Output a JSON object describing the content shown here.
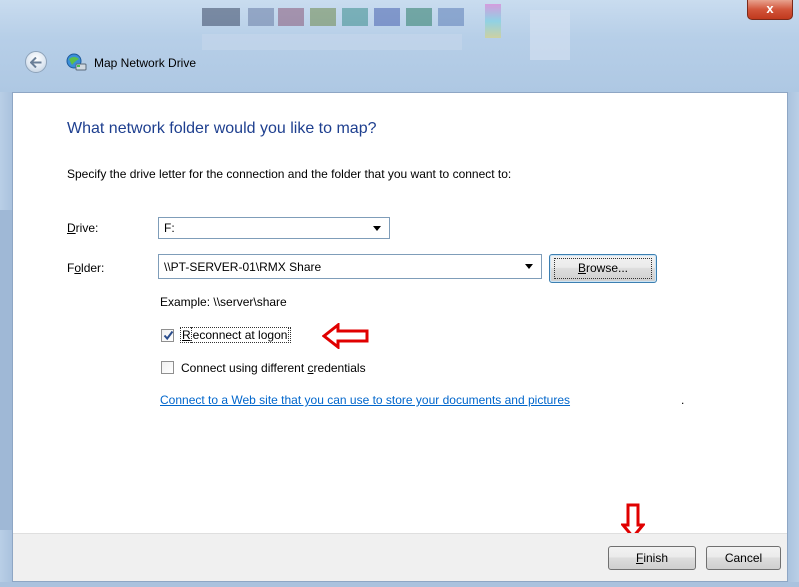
{
  "window": {
    "title": "Map Network Drive",
    "close_glyph": "x"
  },
  "main": {
    "heading": "What network folder would you like to map?",
    "instruction": "Specify the drive letter for the connection and the folder that you want to connect to:"
  },
  "drive": {
    "label_accel": "D",
    "label_rest": "rive:",
    "value": "F:"
  },
  "folder": {
    "label_pre": "F",
    "label_accel": "o",
    "label_rest": "lder:",
    "value": "\\\\PT-SERVER-01\\RMX Share",
    "browse_accel": "B",
    "browse_rest": "rowse..."
  },
  "example_text": "Example: \\\\server\\share",
  "options": {
    "reconnect": {
      "accel": "R",
      "rest": "econnect at logon",
      "checked": true
    },
    "credentials": {
      "pre": "Connect using different ",
      "accel": "c",
      "rest": "redentials",
      "checked": false
    }
  },
  "link": {
    "text": "Connect to a Web site that you can use to store your documents and pictures",
    "trailing": "."
  },
  "footer": {
    "finish_accel": "F",
    "finish_rest": "inish",
    "cancel_label": "Cancel"
  },
  "annotations": {
    "arrow_color": "#e00000"
  },
  "colors": {
    "heading": "#1e3f8f",
    "link": "#0066cc"
  }
}
